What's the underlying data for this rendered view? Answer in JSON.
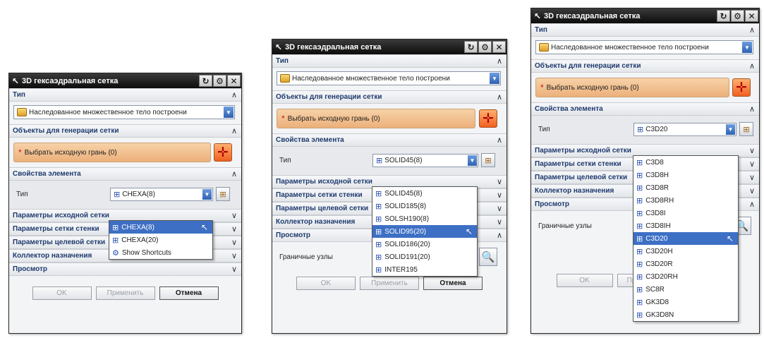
{
  "dialog": {
    "title": "3D гексаэдральная сетка",
    "title_buttons": [
      "↻",
      "⚙",
      "✕"
    ],
    "section_type": "Тип",
    "inherited_value": "Наследованное множественное тело построени",
    "section_objects": "Объекты для генерации сетки",
    "select_face": "Выбрать исходную грань (0)",
    "section_props": "Свойства элемента",
    "type_label": "Тип",
    "source_params": "Параметры исходной сетки",
    "wall_params": "Параметры сетки стенки",
    "target_params": "Параметры целевой сетки",
    "collector": "Коллектор назначения",
    "preview": "Просмотр",
    "boundary_nodes": "Граничные узлы",
    "ok": "OK",
    "apply": "Применить",
    "cancel": "Отмена",
    "chevron_up": "∧",
    "chevron_down": "∨",
    "dropdown_arrow": "▼",
    "star": "*",
    "target_glyph": "✛",
    "mag_glyph": "🔍",
    "info_glyph": "⊞"
  },
  "panel1": {
    "element_type": "CHEXA(8)",
    "options": [
      {
        "label": "CHEXA(8)",
        "icon": "element-icon",
        "highlight": true
      },
      {
        "label": "CHEXA(20)",
        "icon": "element-icon",
        "highlight": false
      },
      {
        "label": "Show Shortcuts",
        "icon": "gear-icon",
        "highlight": false
      }
    ]
  },
  "panel2": {
    "element_type": "SOLID45(8)",
    "options": [
      {
        "label": "SOLID45(8)",
        "highlight": false
      },
      {
        "label": "SOLID185(8)",
        "highlight": false
      },
      {
        "label": "SOLSH190(8)",
        "highlight": false
      },
      {
        "label": "SOLID95(20)",
        "highlight": true
      },
      {
        "label": "SOLID186(20)",
        "highlight": false
      },
      {
        "label": "SOLID191(20)",
        "highlight": false
      },
      {
        "label": "INTER195",
        "highlight": false
      }
    ]
  },
  "panel3": {
    "element_type": "C3D20",
    "options": [
      {
        "label": "C3D8",
        "highlight": false
      },
      {
        "label": "C3D8H",
        "highlight": false
      },
      {
        "label": "C3D8R",
        "highlight": false
      },
      {
        "label": "C3D8RH",
        "highlight": false
      },
      {
        "label": "C3D8I",
        "highlight": false
      },
      {
        "label": "C3D8IH",
        "highlight": false
      },
      {
        "label": "C3D20",
        "highlight": true
      },
      {
        "label": "C3D20H",
        "highlight": false
      },
      {
        "label": "C3D20R",
        "highlight": false
      },
      {
        "label": "C3D20RH",
        "highlight": false
      },
      {
        "label": "SC8R",
        "highlight": false
      },
      {
        "label": "GK3D8",
        "highlight": false
      },
      {
        "label": "GK3D8N",
        "highlight": false
      }
    ]
  },
  "colors": {
    "title_bar": "#0c0c0c",
    "highlight": "#3d6fc4",
    "section_text": "#1e3a6e",
    "select_fill": "#ecb07a"
  }
}
